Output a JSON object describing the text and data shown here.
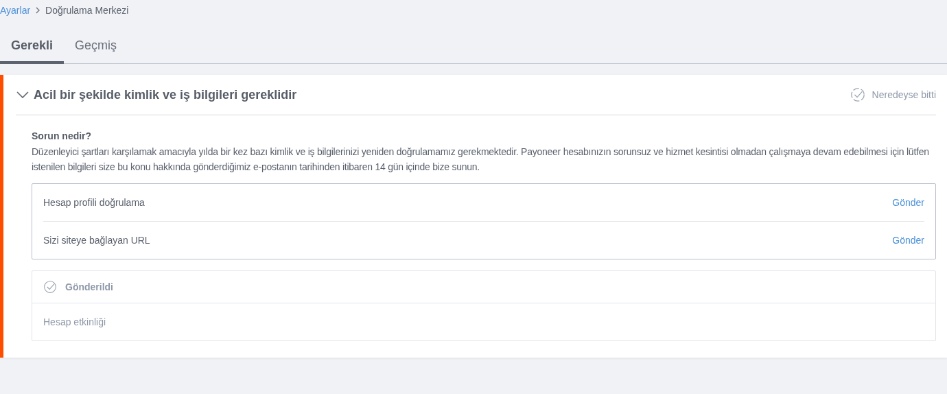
{
  "breadcrumb": [
    {
      "label": "Ayarlar",
      "kind": "link"
    },
    {
      "label": "Doğrulama Merkezi",
      "kind": "current"
    }
  ],
  "tabs": [
    {
      "label": "Gerekli",
      "selected": true
    },
    {
      "label": "Geçmiş",
      "selected": false
    }
  ],
  "card": {
    "title": "Acil bir şekilde kimlik ve iş bilgileri gereklidir",
    "expanded": true,
    "status": "Neredeyse bitti",
    "question": "Sorun nedir?",
    "description": "Düzenleyici şartları karşılamak amacıyla yılda bir kez bazı kimlik ve iş bilgilerinizi yeniden doğrulamamız gerekmektedir. Payoneer hesabınızın sorunsuz ve hizmet kesintisi olmadan çalışmaya devam edebilmesi için lütfen istenilen bilgileri size bu konu hakkında gönderdiğimiz e-postanın tarihinden itibaren 14 gün içinde bize sunun.",
    "required_items": [
      {
        "label": "Hesap profili doğrulama",
        "action": "Gönder"
      },
      {
        "label": "Sizi siteye bağlayan URL",
        "action": "Gönder"
      }
    ],
    "submitted": {
      "title": "Gönderildi",
      "items": [
        "Hesap etkinliği"
      ]
    }
  }
}
